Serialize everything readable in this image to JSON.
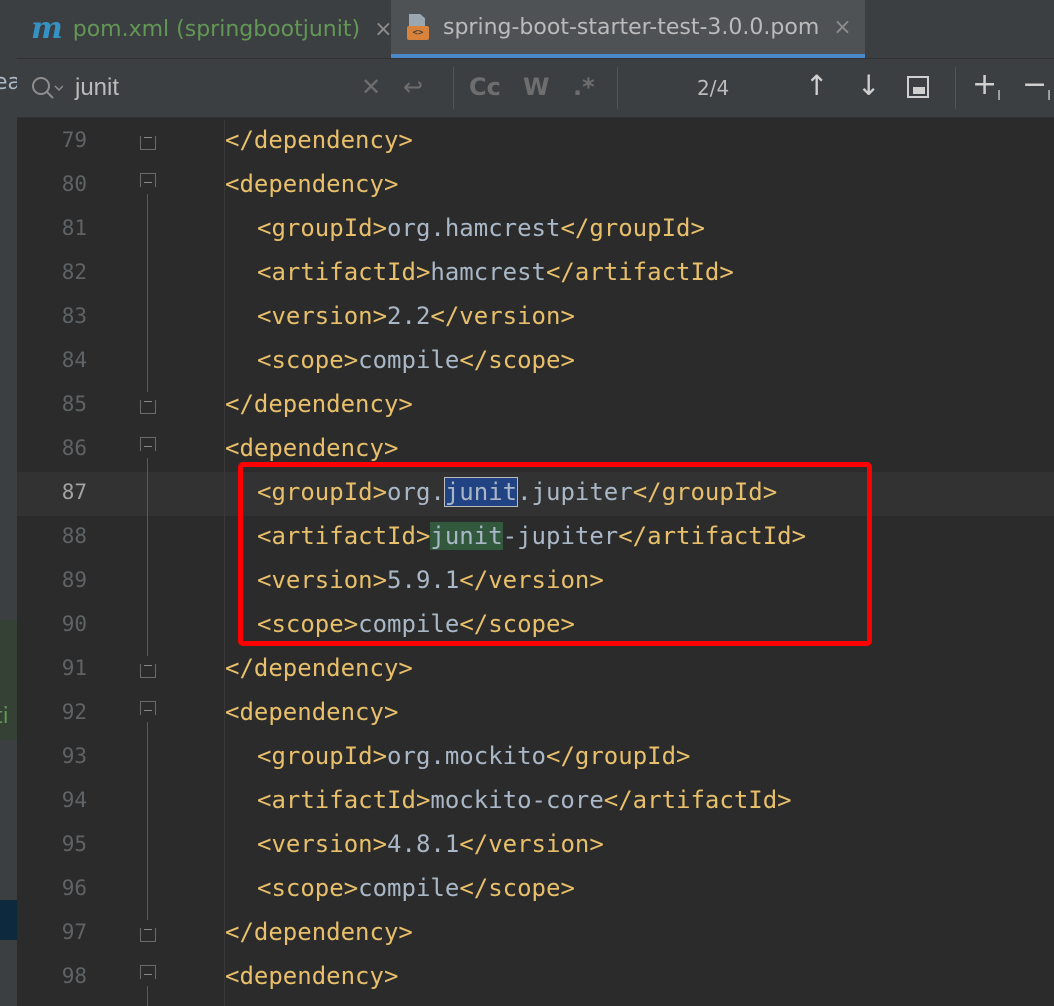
{
  "left_panel": {
    "fragments": [
      "ea",
      "ti"
    ]
  },
  "tabs": [
    {
      "label": "pom.xml (springbootjunit)",
      "icon": "m",
      "active": false
    },
    {
      "label": "spring-boot-starter-test-3.0.0.pom",
      "icon": "<>",
      "active": true
    }
  ],
  "tab_close_glyph": "×",
  "search": {
    "query": "junit",
    "match_case_label": "Cc",
    "words_label": "W",
    "regex_label": ".*",
    "match_count": "2/4"
  },
  "editor": {
    "current_line": "87",
    "lines": [
      {
        "number": "79",
        "indent": "",
        "tokens": [
          {
            "t": "</dependency>",
            "c": "tag"
          }
        ]
      },
      {
        "number": "80",
        "indent": "",
        "tokens": [
          {
            "t": "<dependency>",
            "c": "tag"
          }
        ]
      },
      {
        "number": "81",
        "indent": "  ",
        "tokens": [
          {
            "t": "<groupId>",
            "c": "tag"
          },
          {
            "t": "org.hamcrest"
          },
          {
            "t": "</groupId>",
            "c": "tag"
          }
        ]
      },
      {
        "number": "82",
        "indent": "  ",
        "tokens": [
          {
            "t": "<artifactId>",
            "c": "tag"
          },
          {
            "t": "hamcrest"
          },
          {
            "t": "</artifactId>",
            "c": "tag"
          }
        ]
      },
      {
        "number": "83",
        "indent": "  ",
        "tokens": [
          {
            "t": "<version>",
            "c": "tag"
          },
          {
            "t": "2.2"
          },
          {
            "t": "</version>",
            "c": "tag"
          }
        ]
      },
      {
        "number": "84",
        "indent": "  ",
        "tokens": [
          {
            "t": "<scope>",
            "c": "tag"
          },
          {
            "t": "compile"
          },
          {
            "t": "</scope>",
            "c": "tag"
          }
        ]
      },
      {
        "number": "85",
        "indent": "",
        "tokens": [
          {
            "t": "</dependency>",
            "c": "tag"
          }
        ]
      },
      {
        "number": "86",
        "indent": "",
        "tokens": [
          {
            "t": "<dependency>",
            "c": "tag"
          }
        ]
      },
      {
        "number": "87",
        "indent": "  ",
        "tokens": [
          {
            "t": "<groupId>",
            "c": "tag"
          },
          {
            "t": "org."
          },
          {
            "t": "junit",
            "c": "hl-current"
          },
          {
            "t": ".jupiter"
          },
          {
            "t": "</groupId>",
            "c": "tag"
          }
        ]
      },
      {
        "number": "88",
        "indent": "  ",
        "tokens": [
          {
            "t": "<artifactId>",
            "c": "tag"
          },
          {
            "t": "junit",
            "c": "hl-other"
          },
          {
            "t": "-jupiter"
          },
          {
            "t": "</artifactId>",
            "c": "tag"
          }
        ]
      },
      {
        "number": "89",
        "indent": "  ",
        "tokens": [
          {
            "t": "<version>",
            "c": "tag"
          },
          {
            "t": "5.9.1"
          },
          {
            "t": "</version>",
            "c": "tag"
          }
        ]
      },
      {
        "number": "90",
        "indent": "  ",
        "tokens": [
          {
            "t": "<scope>",
            "c": "tag"
          },
          {
            "t": "compile"
          },
          {
            "t": "</scope>",
            "c": "tag"
          }
        ]
      },
      {
        "number": "91",
        "indent": "",
        "tokens": [
          {
            "t": "</dependency>",
            "c": "tag"
          }
        ]
      },
      {
        "number": "92",
        "indent": "",
        "tokens": [
          {
            "t": "<dependency>",
            "c": "tag"
          }
        ]
      },
      {
        "number": "93",
        "indent": "  ",
        "tokens": [
          {
            "t": "<groupId>",
            "c": "tag"
          },
          {
            "t": "org.mockito"
          },
          {
            "t": "</groupId>",
            "c": "tag"
          }
        ]
      },
      {
        "number": "94",
        "indent": "  ",
        "tokens": [
          {
            "t": "<artifactId>",
            "c": "tag"
          },
          {
            "t": "mockito-core"
          },
          {
            "t": "</artifactId>",
            "c": "tag"
          }
        ]
      },
      {
        "number": "95",
        "indent": "  ",
        "tokens": [
          {
            "t": "<version>",
            "c": "tag"
          },
          {
            "t": "4.8.1"
          },
          {
            "t": "</version>",
            "c": "tag"
          }
        ]
      },
      {
        "number": "96",
        "indent": "  ",
        "tokens": [
          {
            "t": "<scope>",
            "c": "tag"
          },
          {
            "t": "compile"
          },
          {
            "t": "</scope>",
            "c": "tag"
          }
        ]
      },
      {
        "number": "97",
        "indent": "",
        "tokens": [
          {
            "t": "</dependency>",
            "c": "tag"
          }
        ]
      },
      {
        "number": "98",
        "indent": "",
        "tokens": [
          {
            "t": "<dependency>",
            "c": "tag"
          }
        ]
      }
    ]
  },
  "colors": {
    "tag": "#e8bf6a",
    "text": "#a9b7c6",
    "current_match": "#214283",
    "other_match": "#32593d",
    "annotation": "#ff0000"
  }
}
